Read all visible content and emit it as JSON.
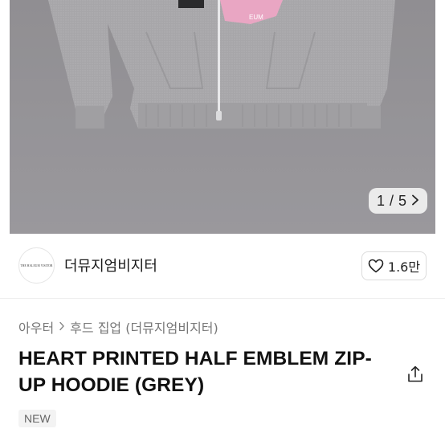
{
  "gallery": {
    "current": "1",
    "separator": "/",
    "total": "5",
    "next_icon": "chevron-right-icon",
    "background": "#959497"
  },
  "brand": {
    "logo_text": "THE HALEUM VISITOR",
    "name": "더뮤지엄비지터",
    "like_icon": "heart-outline-icon",
    "like_count": "1.6만"
  },
  "breadcrumb": {
    "items": [
      "아우터",
      "후드 집업 (더뮤지엄비지터)"
    ],
    "separator_icon": "chevron-right-icon"
  },
  "product": {
    "title": "HEART PRINTED HALF EMBLEM ZIP-UP HOODIE (GREY)",
    "share_icon": "share-icon",
    "badge": "NEW"
  }
}
